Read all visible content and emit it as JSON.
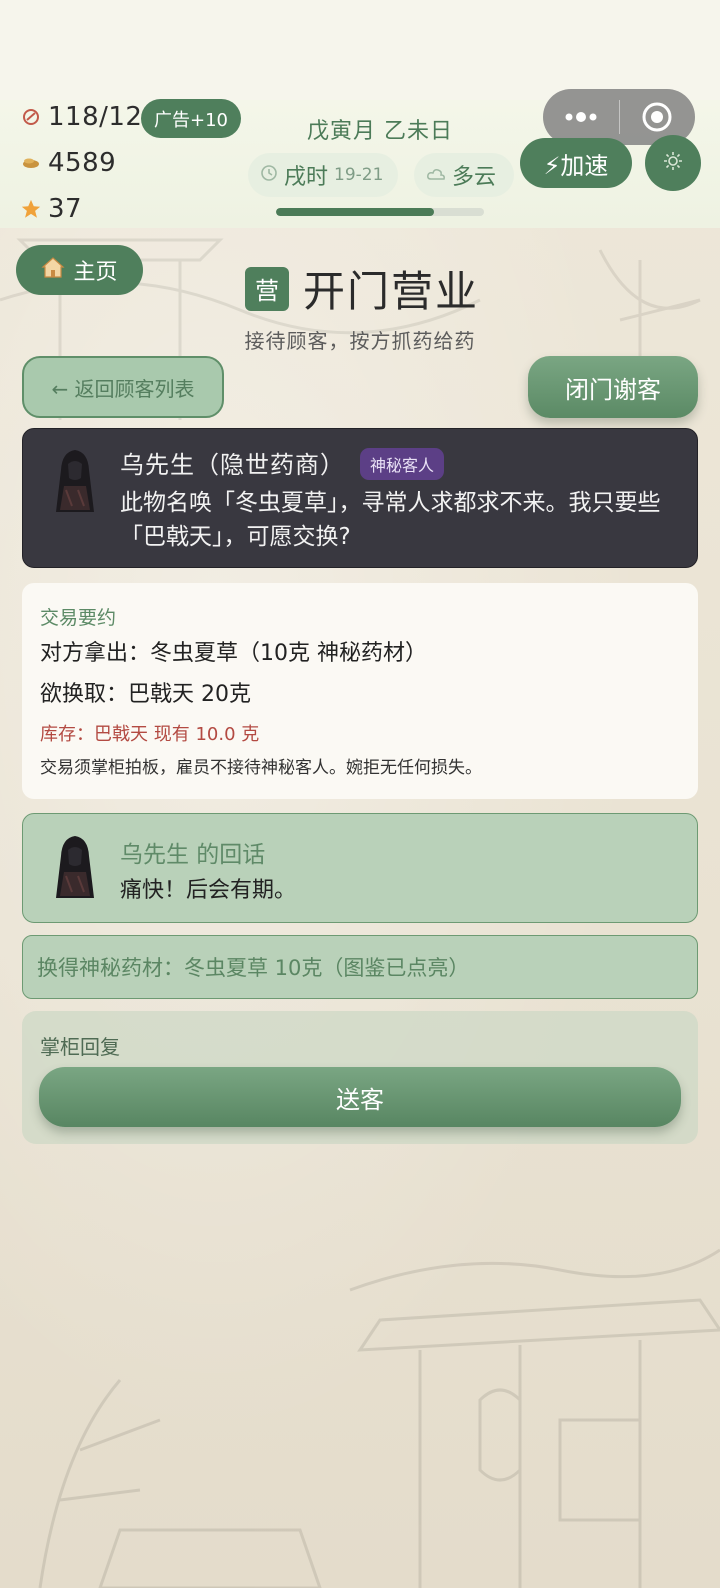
{
  "colors": {
    "primary_green": "#4f7f5c",
    "dark_card": "#393840",
    "tag_purple": "#5c3f86",
    "stock_red": "#b34a42",
    "light_green_card": "#b9d1b9"
  },
  "status": {
    "stamina": {
      "icon": "stamina-icon",
      "value": "118/120"
    },
    "ad_badge": "广告+10",
    "coins": {
      "icon": "coin-icon",
      "value": "4589"
    },
    "stars": {
      "icon": "star-icon",
      "value": "37"
    }
  },
  "calendar": {
    "date": "戊寅月 乙未日",
    "time": {
      "icon": "clock-icon",
      "label": "戌时",
      "range": "19-21"
    },
    "weather": {
      "icon": "cloud-icon",
      "label": "多云"
    },
    "day_progress": 0.76
  },
  "controls": {
    "menu_icon": "more-dots-icon",
    "close_icon": "target-icon",
    "speed_label": "⚡加速",
    "settings_icon": "gear-icon"
  },
  "nav": {
    "home_label": "主页"
  },
  "header": {
    "title_icon": "营",
    "title": "开门营业",
    "subtitle": "接待顾客，按方抓药给药"
  },
  "actions": {
    "back_label": "← 返回顾客列表",
    "close_shop_label": "闭门谢客"
  },
  "customer": {
    "name": "乌先生（隐世药商）",
    "tag": "神秘客人",
    "speech": "此物名唤「冬虫夏草」，寻常人求都求不来。我只要些「巴戟天」，可愿交换?"
  },
  "trade": {
    "heading": "交易要约",
    "offer": "对方拿出：冬虫夏草（10克 神秘药材）",
    "want": "欲换取：巴戟天 20克",
    "stock": "库存：巴戟天 现有 10.0 克",
    "note": "交易须掌柜拍板，雇员不接待神秘客人。婉拒无任何损失。"
  },
  "reply": {
    "title": "乌先生 的回话",
    "text": "痛快！后会有期。"
  },
  "result": "换得神秘药材：冬虫夏草 10克（图鉴已点亮）",
  "keeper": {
    "label": "掌柜回复",
    "send_label": "送客"
  }
}
